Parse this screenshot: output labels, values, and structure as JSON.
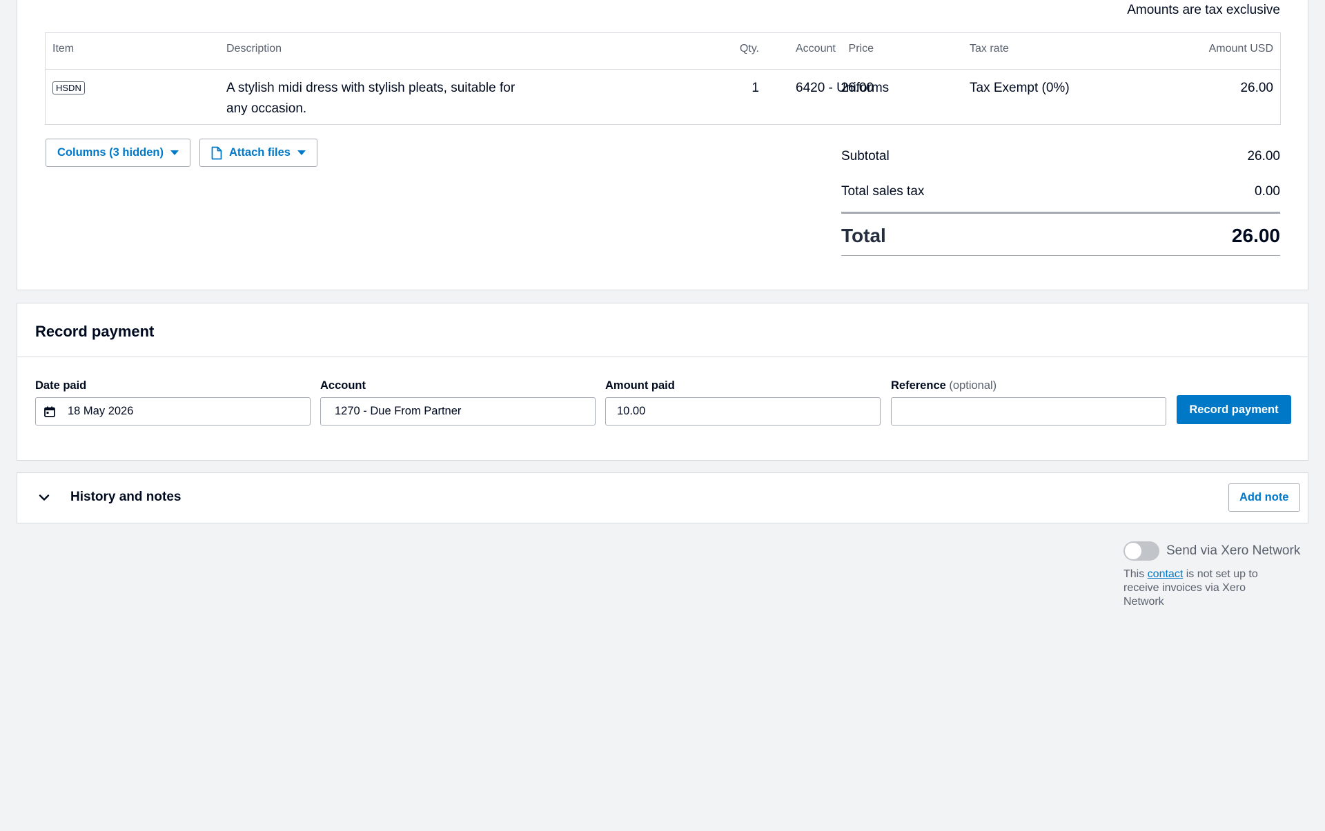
{
  "invoice": {
    "tax_note": "Amounts are tax exclusive",
    "columns": {
      "item": "Item",
      "description": "Description",
      "qty": "Qty.",
      "price": "Price",
      "account": "Account",
      "tax_rate": "Tax rate",
      "amount": "Amount USD"
    },
    "row": {
      "item_code": "HSDN",
      "description": "A stylish midi dress with stylish pleats, suitable for any occasion.",
      "qty": "1",
      "price": "26.00",
      "account": "6420 - Uniforms",
      "tax_rate": "Tax Exempt (0%)",
      "amount": "26.00"
    },
    "columns_button": "Columns (3 hidden)",
    "attach_button": "Attach files",
    "totals": {
      "subtotal_label": "Subtotal",
      "subtotal_value": "26.00",
      "tax_label": "Total sales tax",
      "tax_value": "0.00",
      "total_label": "Total",
      "total_value": "26.00"
    }
  },
  "payment": {
    "title": "Record payment",
    "date_label": "Date paid",
    "date_value": "18 May 2026",
    "account_label": "Account",
    "account_value": "1270 - Due From Partner",
    "amount_label": "Amount paid",
    "amount_value": "10.00",
    "reference_label": "Reference",
    "reference_optional": "(optional)",
    "reference_value": "",
    "submit": "Record payment"
  },
  "history": {
    "title": "History and notes",
    "add_note": "Add note"
  },
  "network": {
    "toggle_label": "Send via Xero Network",
    "toggle_on": false,
    "help_prefix": "This ",
    "help_link": "contact",
    "help_suffix": " is not set up to receive invoices via Xero Network"
  },
  "colors": {
    "accent": "#0078c8",
    "border": "#d6d9dd",
    "background": "#f2f3f4"
  }
}
